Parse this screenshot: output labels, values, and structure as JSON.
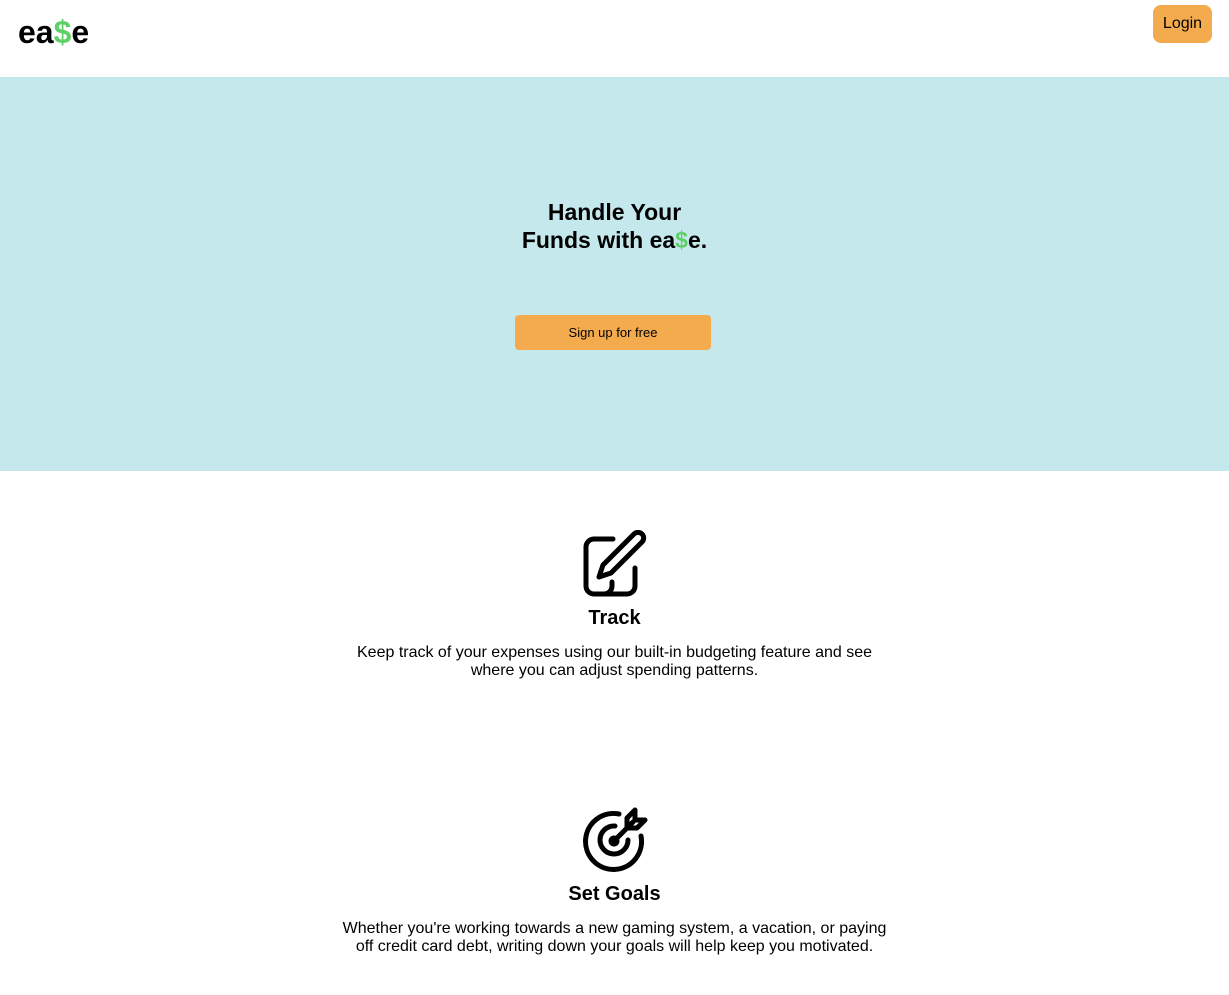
{
  "header": {
    "logo": {
      "prefix": "ea",
      "symbol": "$",
      "suffix": "e"
    },
    "login_label": "Login"
  },
  "hero": {
    "title_line1": "Handle Your",
    "title_line2_prefix": "Funds with ea",
    "title_line2_symbol": "$",
    "title_line2_suffix": "e.",
    "signup_label": "Sign up for free"
  },
  "features": [
    {
      "icon": "edit-icon",
      "title": "Track",
      "description": "Keep track of your expenses using our built-in budgeting feature and see where you can adjust spending patterns."
    },
    {
      "icon": "target-icon",
      "title": "Set Goals",
      "description": "Whether you're working towards a new gaming system, a vacation, or paying off credit card debt, writing down your goals will help keep you motivated."
    }
  ],
  "colors": {
    "accent": "#f4ab4e",
    "hero_bg": "#c4e8ec",
    "dollar": "#5fd068"
  }
}
